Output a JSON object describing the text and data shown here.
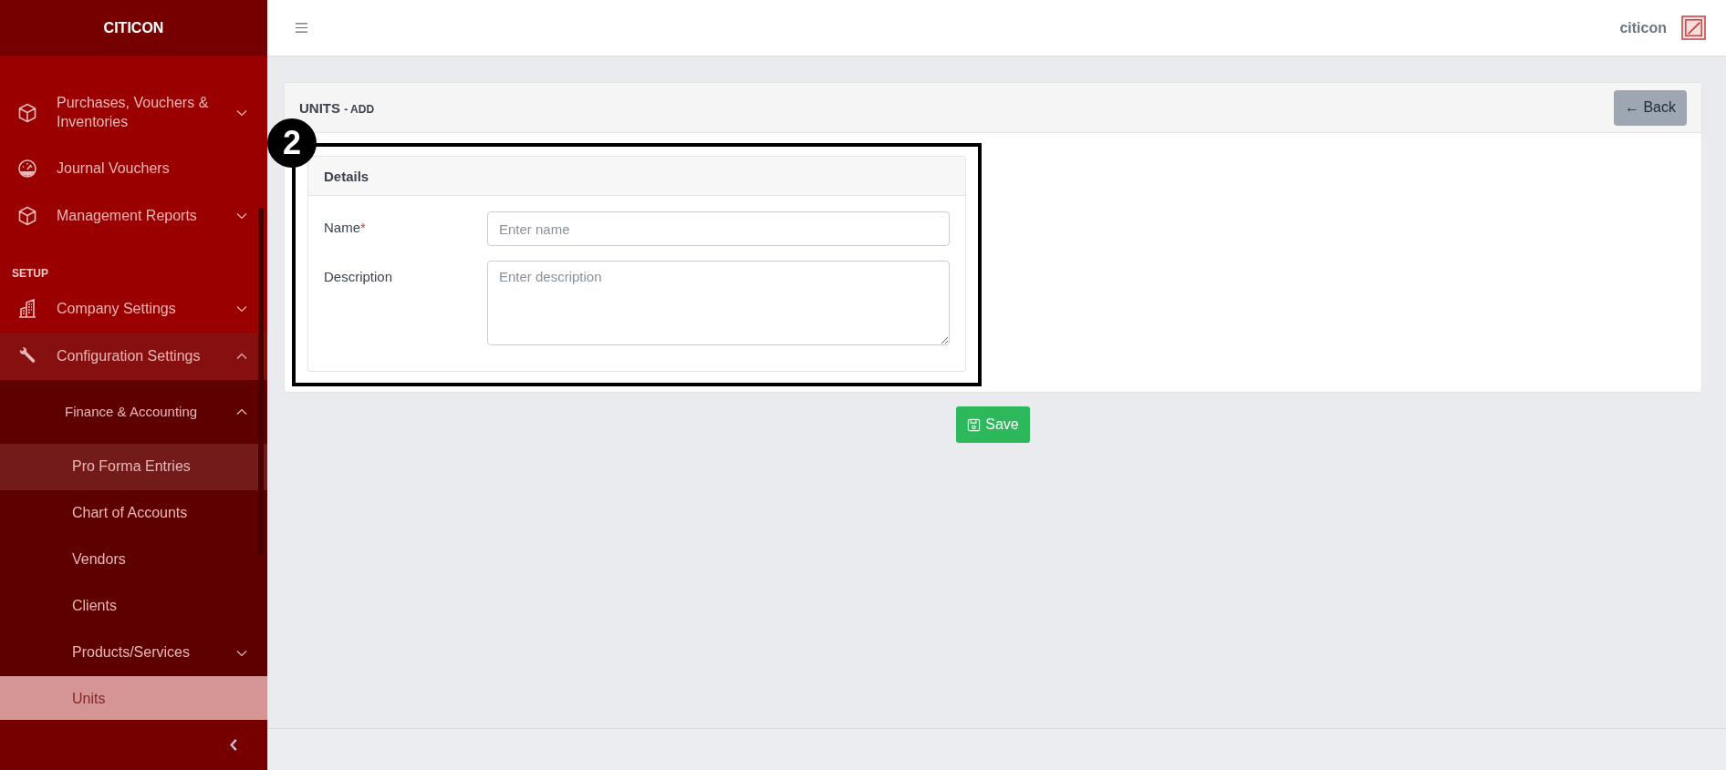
{
  "sidebar": {
    "brand": "CITICON",
    "items": [
      {
        "kind": "group",
        "label": "Purchases, Vouchers & Inventories",
        "expanded": false
      },
      {
        "kind": "link",
        "label": "Journal Vouchers"
      },
      {
        "kind": "group",
        "label": "Management Reports",
        "expanded": false
      },
      {
        "kind": "heading",
        "label": "SETUP"
      },
      {
        "kind": "group",
        "label": "Company Settings",
        "expanded": false
      },
      {
        "kind": "group",
        "label": "Configuration Settings",
        "expanded": true,
        "children": [
          {
            "label": "Finance & Accounting",
            "expanded": true,
            "children": [
              {
                "kind": "link",
                "label": "Pro Forma Entries",
                "highlighted": true,
                "selected": false
              },
              {
                "kind": "link",
                "label": "Chart of Accounts",
                "highlighted": false,
                "selected": false
              },
              {
                "kind": "link",
                "label": "Vendors",
                "highlighted": false,
                "selected": false
              },
              {
                "kind": "link",
                "label": "Clients",
                "highlighted": false,
                "selected": false
              },
              {
                "kind": "group",
                "label": "Products/Services",
                "expanded": false,
                "highlighted": false,
                "selected": false
              },
              {
                "kind": "link",
                "label": "Units",
                "highlighted": false,
                "selected": true
              }
            ]
          }
        ]
      }
    ]
  },
  "header": {
    "user": "citicon"
  },
  "page": {
    "title": "UNITS",
    "subtitle": "- ADD",
    "back_button": "← Back",
    "callout": "2",
    "section": {
      "title": "Details",
      "fields": [
        {
          "kind": "input",
          "label": "Name",
          "required_mark": "*",
          "placeholder": "Enter name"
        },
        {
          "kind": "textarea",
          "label": "Description",
          "placeholder": "Enter description"
        }
      ]
    },
    "save_button": "Save"
  }
}
